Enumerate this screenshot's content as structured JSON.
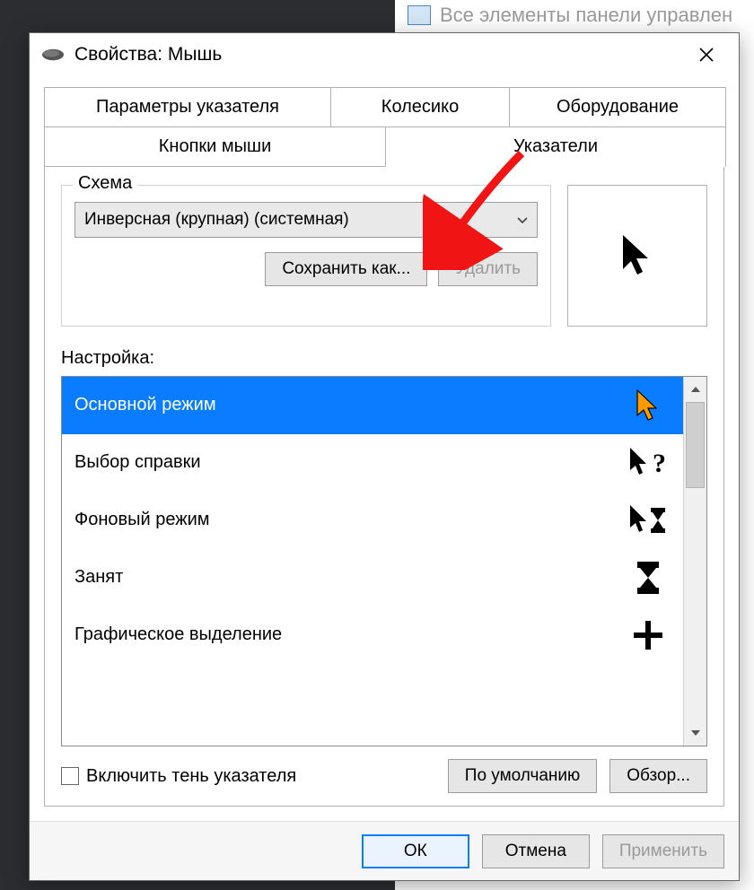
{
  "backdrop": {
    "cp_label": "Все элементы панели управлен"
  },
  "dialog": {
    "title": "Свойства: Мышь",
    "tabs": {
      "pointer_options": "Параметры указателя",
      "wheel": "Колесико",
      "hardware": "Оборудование",
      "buttons": "Кнопки мыши",
      "pointers": "Указатели"
    },
    "scheme": {
      "legend": "Схема",
      "selected": "Инверсная (крупная) (системная)",
      "save_as": "Сохранить как...",
      "delete": "Удалить"
    },
    "customize_label": "Настройка:",
    "items": [
      {
        "label": "Основной режим",
        "icon": "arrow-orange"
      },
      {
        "label": "Выбор справки",
        "icon": "arrow-help"
      },
      {
        "label": "Фоновый режим",
        "icon": "arrow-busy"
      },
      {
        "label": "Занят",
        "icon": "hourglass"
      },
      {
        "label": "Графическое выделение",
        "icon": "crosshair"
      }
    ],
    "shadow_checkbox": "Включить тень указателя",
    "defaults_btn": "По умолчанию",
    "browse_btn": "Обзор...",
    "ok": "ОК",
    "cancel": "Отмена",
    "apply": "Применить"
  }
}
